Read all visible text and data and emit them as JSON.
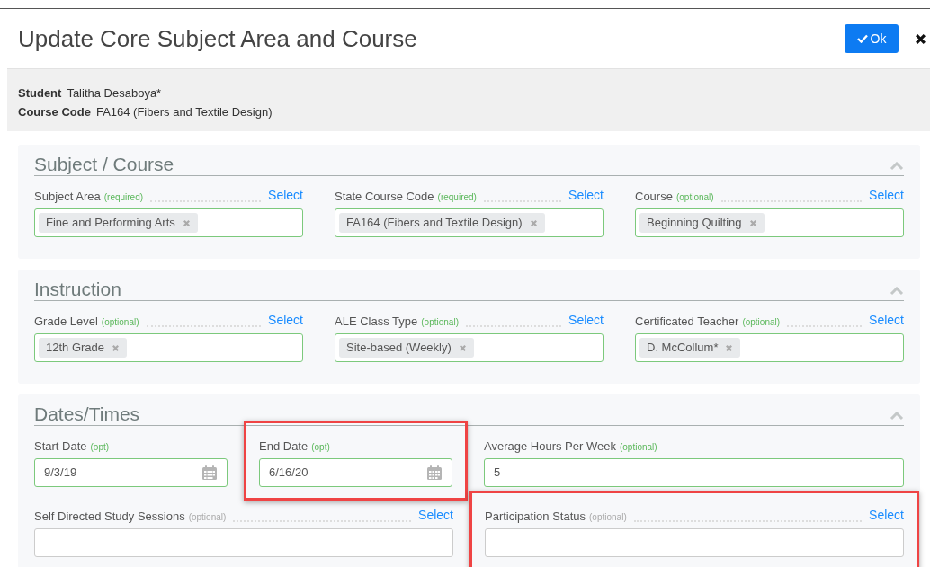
{
  "dialog": {
    "title": "Update Core Subject Area and Course",
    "ok_button": "Ok"
  },
  "summary": [
    {
      "label": "Student",
      "value": "Talitha Desaboya*"
    },
    {
      "label": "Course Code",
      "value": "FA164 (Fibers and Textile Design)"
    }
  ],
  "sections": [
    {
      "title": "Subject / Course",
      "expanded": true,
      "lines": [
        {
          "fields": [
            {
              "kind": "select",
              "label": "Subject Area",
              "hint": "(required)",
              "valid": true,
              "action": "Select",
              "tags": [
                "Fine and Performing Arts"
              ],
              "highlighted": false
            },
            {
              "kind": "select",
              "label": "State Course Code",
              "hint": "(required)",
              "valid": true,
              "action": "Select",
              "tags": [
                "FA164 (Fibers and Textile Design)"
              ],
              "highlighted": false
            },
            {
              "kind": "select",
              "label": "Course",
              "hint": "(optional)",
              "valid": true,
              "action": "Select",
              "tags": [
                "Beginning Quilting"
              ],
              "highlighted": false
            }
          ]
        }
      ]
    },
    {
      "title": "Instruction",
      "expanded": true,
      "lines": [
        {
          "fields": [
            {
              "kind": "select",
              "label": "Grade Level",
              "hint": "(optional)",
              "valid": true,
              "action": "Select",
              "tags": [
                "12th Grade"
              ],
              "highlighted": false
            },
            {
              "kind": "select",
              "label": "ALE Class Type",
              "hint": "(optional)",
              "valid": true,
              "action": "Select",
              "tags": [
                "Site-based (Weekly)"
              ],
              "highlighted": false
            },
            {
              "kind": "select",
              "label": "Certificated Teacher",
              "hint": "(optional)",
              "valid": true,
              "action": "Select",
              "tags": [
                "D. McCollum*"
              ],
              "highlighted": false
            }
          ]
        }
      ]
    },
    {
      "title": "Dates/Times",
      "expanded": true,
      "lines": [
        {
          "fields": [
            {
              "kind": "date",
              "label": "Start Date",
              "hint": "(opt)",
              "valid": true,
              "value": "9/3/19",
              "highlighted": false
            },
            {
              "kind": "date",
              "label": "End Date",
              "hint": "(opt)",
              "valid": true,
              "value": "6/16/20",
              "highlighted": true
            },
            {
              "kind": "text",
              "label": "Average Hours Per Week",
              "hint": "(optional)",
              "valid": true,
              "value": "5",
              "highlighted": false
            }
          ]
        },
        {
          "fields": [
            {
              "kind": "select",
              "label": "Self Directed Study Sessions",
              "hint": "(optional)",
              "valid": false,
              "action": "Select",
              "highlighted": false
            },
            {
              "kind": "select",
              "label": "Participation Status",
              "hint": "(optional)",
              "valid": false,
              "action": "Select",
              "highlighted": true
            }
          ]
        }
      ]
    }
  ]
}
